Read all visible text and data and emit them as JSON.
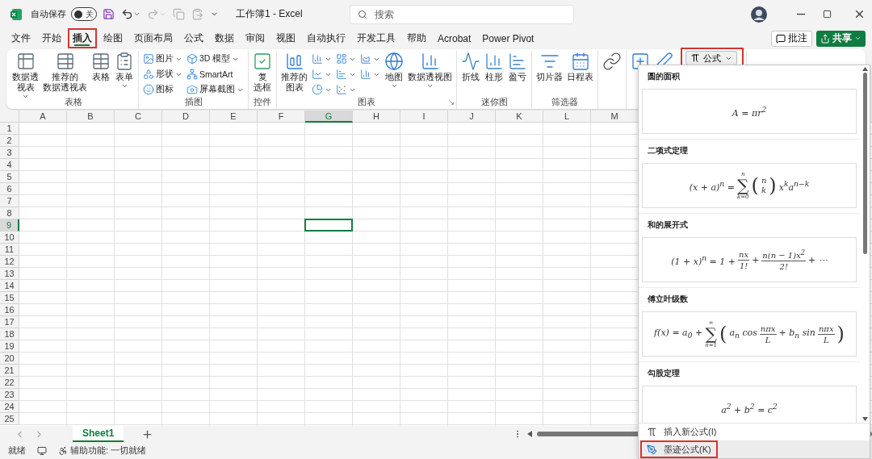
{
  "title_bar": {
    "autosave_label": "自动保存",
    "autosave": {
      "on": false,
      "label": "关"
    },
    "quick_access": [
      {
        "disabled": false
      },
      {
        "disabled": false,
        "dropdown": true
      },
      {
        "disabled": true,
        "dropdown": true
      },
      {
        "disabled": true
      },
      {
        "disabled": true
      }
    ],
    "title": "工作簿1 - Excel",
    "search": {
      "placeholder": "搜索"
    }
  },
  "menu_tabs": [
    {
      "label": "文件",
      "selected": false,
      "highlighted": false
    },
    {
      "label": "开始",
      "selected": false,
      "highlighted": false
    },
    {
      "label": "插入",
      "selected": true,
      "highlighted": true
    },
    {
      "label": "绘图",
      "selected": false,
      "highlighted": false
    },
    {
      "label": "页面布局",
      "selected": false,
      "highlighted": false
    },
    {
      "label": "公式",
      "selected": false,
      "highlighted": false
    },
    {
      "label": "数据",
      "selected": false,
      "highlighted": false
    },
    {
      "label": "审阅",
      "selected": false,
      "highlighted": false
    },
    {
      "label": "视图",
      "selected": false,
      "highlighted": false
    },
    {
      "label": "自动执行",
      "selected": false,
      "highlighted": false
    },
    {
      "label": "开发工具",
      "selected": false,
      "highlighted": false
    },
    {
      "label": "帮助",
      "selected": false,
      "highlighted": false
    },
    {
      "label": "Acrobat",
      "selected": false,
      "highlighted": false
    },
    {
      "label": "Power Pivot",
      "selected": false,
      "highlighted": false
    }
  ],
  "actions": {
    "comments": "批注",
    "share": "共享"
  },
  "ribbon": {
    "groups": [
      {
        "label": "表格",
        "items": [
          {
            "kind": "large",
            "lines": [
              "数据透",
              "视表"
            ],
            "dropdown": true
          },
          {
            "kind": "large",
            "lines": [
              "推荐的",
              "数据透视表"
            ]
          },
          {
            "kind": "large",
            "lines": [
              "表格"
            ]
          },
          {
            "kind": "large",
            "lines": [
              "表单"
            ],
            "dropdown": true
          }
        ]
      },
      {
        "label": "插图",
        "items": [
          {
            "kind": "stack",
            "items": [
              {
                "label": "图片",
                "dropdown": true
              },
              {
                "label": "形状",
                "dropdown": true
              },
              {
                "label": "图标"
              }
            ]
          },
          {
            "kind": "stack",
            "items": [
              {
                "label": "3D 模型",
                "dropdown": true
              },
              {
                "label": "SmartArt"
              },
              {
                "label": "屏幕截图",
                "dropdown": true
              }
            ]
          }
        ]
      },
      {
        "label": "控件",
        "items": [
          {
            "kind": "large",
            "lines": [
              "复",
              "选框"
            ]
          }
        ]
      },
      {
        "label": "图表",
        "launcher": true,
        "items": [
          {
            "kind": "large",
            "lines": [
              "推荐的",
              "图表"
            ]
          },
          {
            "kind": "stack",
            "items": [
              {
                "dropdown": true
              },
              {
                "dropdown": true
              },
              {
                "dropdown": true
              }
            ]
          },
          {
            "kind": "stack",
            "items": [
              {
                "dropdown": true
              },
              {
                "dropdown": true
              },
              {
                "dropdown": true
              }
            ]
          },
          {
            "kind": "stack",
            "items": [
              {
                "dropdown": true
              },
              {
                "dropdown": true
              }
            ]
          },
          {
            "kind": "large",
            "lines": [
              "地图"
            ],
            "dropdown": true
          },
          {
            "kind": "large",
            "lines": [
              "数据透视图"
            ],
            "dropdown": true
          }
        ]
      },
      {
        "label": "迷你图",
        "items": [
          {
            "kind": "large",
            "lines": [
              "折线"
            ]
          },
          {
            "kind": "large",
            "lines": [
              "柱形"
            ]
          },
          {
            "kind": "large",
            "lines": [
              "盈亏"
            ]
          }
        ]
      },
      {
        "label": "筛选器",
        "items": [
          {
            "kind": "large",
            "lines": [
              "切片器"
            ]
          },
          {
            "kind": "large",
            "lines": [
              "日程表"
            ]
          }
        ]
      },
      {
        "items": [
          {
            "kind": "large"
          }
        ]
      },
      {
        "items": [
          {
            "kind": "large"
          },
          {
            "kind": "large"
          }
        ]
      }
    ]
  },
  "equation_button": {
    "label": "公式",
    "dropdown": true,
    "highlighted": true
  },
  "sheet": {
    "columns": [
      {
        "label": "A",
        "selected": false
      },
      {
        "label": "B",
        "selected": false
      },
      {
        "label": "C",
        "selected": false
      },
      {
        "label": "D",
        "selected": false
      },
      {
        "label": "E",
        "selected": false
      },
      {
        "label": "F",
        "selected": false
      },
      {
        "label": "G",
        "selected": true
      },
      {
        "label": "H",
        "selected": false
      },
      {
        "label": "I",
        "selected": false
      },
      {
        "label": "J",
        "selected": false
      },
      {
        "label": "K",
        "selected": false
      },
      {
        "label": "L",
        "selected": false
      },
      {
        "label": "M",
        "selected": false
      }
    ],
    "rows": [
      {
        "label": "1",
        "selected": false
      },
      {
        "label": "2",
        "selected": false
      },
      {
        "label": "3",
        "selected": false
      },
      {
        "label": "4",
        "selected": false
      },
      {
        "label": "5",
        "selected": false
      },
      {
        "label": "6",
        "selected": false
      },
      {
        "label": "7",
        "selected": false
      },
      {
        "label": "8",
        "selected": false
      },
      {
        "label": "9",
        "selected": true
      },
      {
        "label": "10",
        "selected": false
      },
      {
        "label": "11",
        "selected": false
      },
      {
        "label": "12",
        "selected": false
      },
      {
        "label": "13",
        "selected": false
      },
      {
        "label": "14",
        "selected": false
      },
      {
        "label": "15",
        "selected": false
      },
      {
        "label": "16",
        "selected": false
      },
      {
        "label": "17",
        "selected": false
      },
      {
        "label": "18",
        "selected": false
      },
      {
        "label": "19",
        "selected": false
      },
      {
        "label": "20",
        "selected": false
      },
      {
        "label": "21",
        "selected": false
      },
      {
        "label": "22",
        "selected": false
      },
      {
        "label": "23",
        "selected": false
      },
      {
        "label": "24",
        "selected": false
      },
      {
        "label": "25",
        "selected": false
      }
    ]
  },
  "equation_gallery": {
    "sections": [
      {
        "title": "圆的面积",
        "formula": [
          {
            "kind": "text",
            "text": "A = πr$^{2}$"
          }
        ]
      },
      {
        "title": "二项式定理",
        "formula": [
          {
            "kind": "text",
            "text": "(x + a)$^{n}$ ="
          },
          {
            "kind": "sum",
            "sign": "∑",
            "top": "n",
            "bottom": "k=0"
          },
          {
            "kind": "delim",
            "text": "("
          },
          {
            "kind": "stack",
            "top": "n",
            "bottom": "k"
          },
          {
            "kind": "delim",
            "text": ")"
          },
          {
            "kind": "text",
            "text": "x$^{k}$a$^{n−k}$"
          }
        ]
      },
      {
        "title": "和的展开式",
        "formula": [
          {
            "kind": "text",
            "text": "(1 + x)$^{n}$ = 1 +"
          },
          {
            "kind": "frac",
            "num": "nx",
            "den": "1!"
          },
          {
            "kind": "text",
            "text": "+"
          },
          {
            "kind": "frac",
            "num": "n(n − 1)x$^{2}$",
            "den": "2!"
          },
          {
            "kind": "text",
            "text": "+ ⋯"
          }
        ]
      },
      {
        "title": "傅立叶级数",
        "formula": [
          {
            "kind": "text",
            "text": "f(x) = a$_{0}$ +"
          },
          {
            "kind": "sum",
            "sign": "∑",
            "top": "∞",
            "bottom": "n=1"
          },
          {
            "kind": "delim",
            "text": "("
          },
          {
            "kind": "text",
            "text": "a$_{n}$ cos"
          },
          {
            "kind": "frac",
            "num": "nπx",
            "den": "L"
          },
          {
            "kind": "text",
            "text": "+ b$_{n}$ sin"
          },
          {
            "kind": "frac",
            "num": "nπx",
            "den": "L"
          },
          {
            "kind": "delim",
            "text": ")"
          }
        ]
      },
      {
        "title": "勾股定理",
        "formula": [
          {
            "kind": "text",
            "text": "a$^{2}$ + b$^{2}$ = c$^{2}$"
          }
        ]
      }
    ],
    "footer": [
      {
        "label": "插入新公式(I)",
        "hovered": false,
        "highlighted": false
      },
      {
        "label": "墨迹公式(K)",
        "hovered": true,
        "highlighted": true
      }
    ]
  },
  "sheet_tabs": [
    {
      "label": "Sheet1",
      "selected": true
    }
  ],
  "status_bar": {
    "ready": "就绪",
    "accessibility": "辅助功能: 一切就绪"
  }
}
